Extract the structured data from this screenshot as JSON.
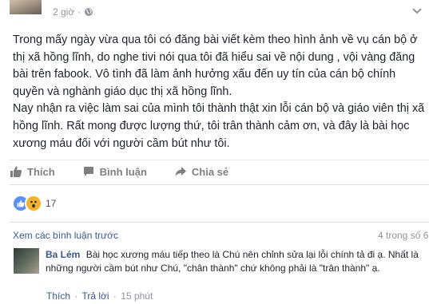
{
  "post": {
    "timestamp": "2 giờ",
    "paragraphs": [
      "Trong mấy ngày vừa qua tôi có đăng bài viết kèm theo hình ảnh về vụ cán bộ ở thị xã hồng lĩnh, do nghe tivi nói qua tôi đã hiểu sai về nội dung , vội vàng đăng bài trên fabook. Vô tình đã làm ảnh hưởng xấu đến uy tín của cán bộ chính quyền và nghành giáo dục thị xã hồng lĩnh.",
      "Nay nhận ra việc làm sai của mình tôi thành thật xin lỗi cán bộ và giáo viên thị xã hồng lĩnh. Rất mong được lượng thứ, tôi trân thành cảm ơn, và đây là bài học xương máu đối với người cầm bút như tôi."
    ]
  },
  "actions": {
    "like": "Thích",
    "comment": "Bình luận",
    "share": "Chia sẻ"
  },
  "reactions": {
    "count": "17",
    "icons": [
      "like-icon",
      "wow-icon"
    ]
  },
  "comments": {
    "view_previous": "Xem các bình luận trước",
    "count_of": "4 trong số 6",
    "items": [
      {
        "author": "Ba Lém",
        "text": "Bài học xương máu tiếp theo là Chú nên chỉnh sửa lại lỗi chính tả đi ạ. Nhất là những người cầm bút như Chú, \"chân thành\" chứ không phải là \"trân thành\" ạ.",
        "like": "Thích",
        "reply": "Trả lời",
        "time": "15 phút"
      }
    ]
  },
  "colors": {
    "link": "#365899",
    "muted": "#90949c",
    "action": "#7f7f7f"
  }
}
